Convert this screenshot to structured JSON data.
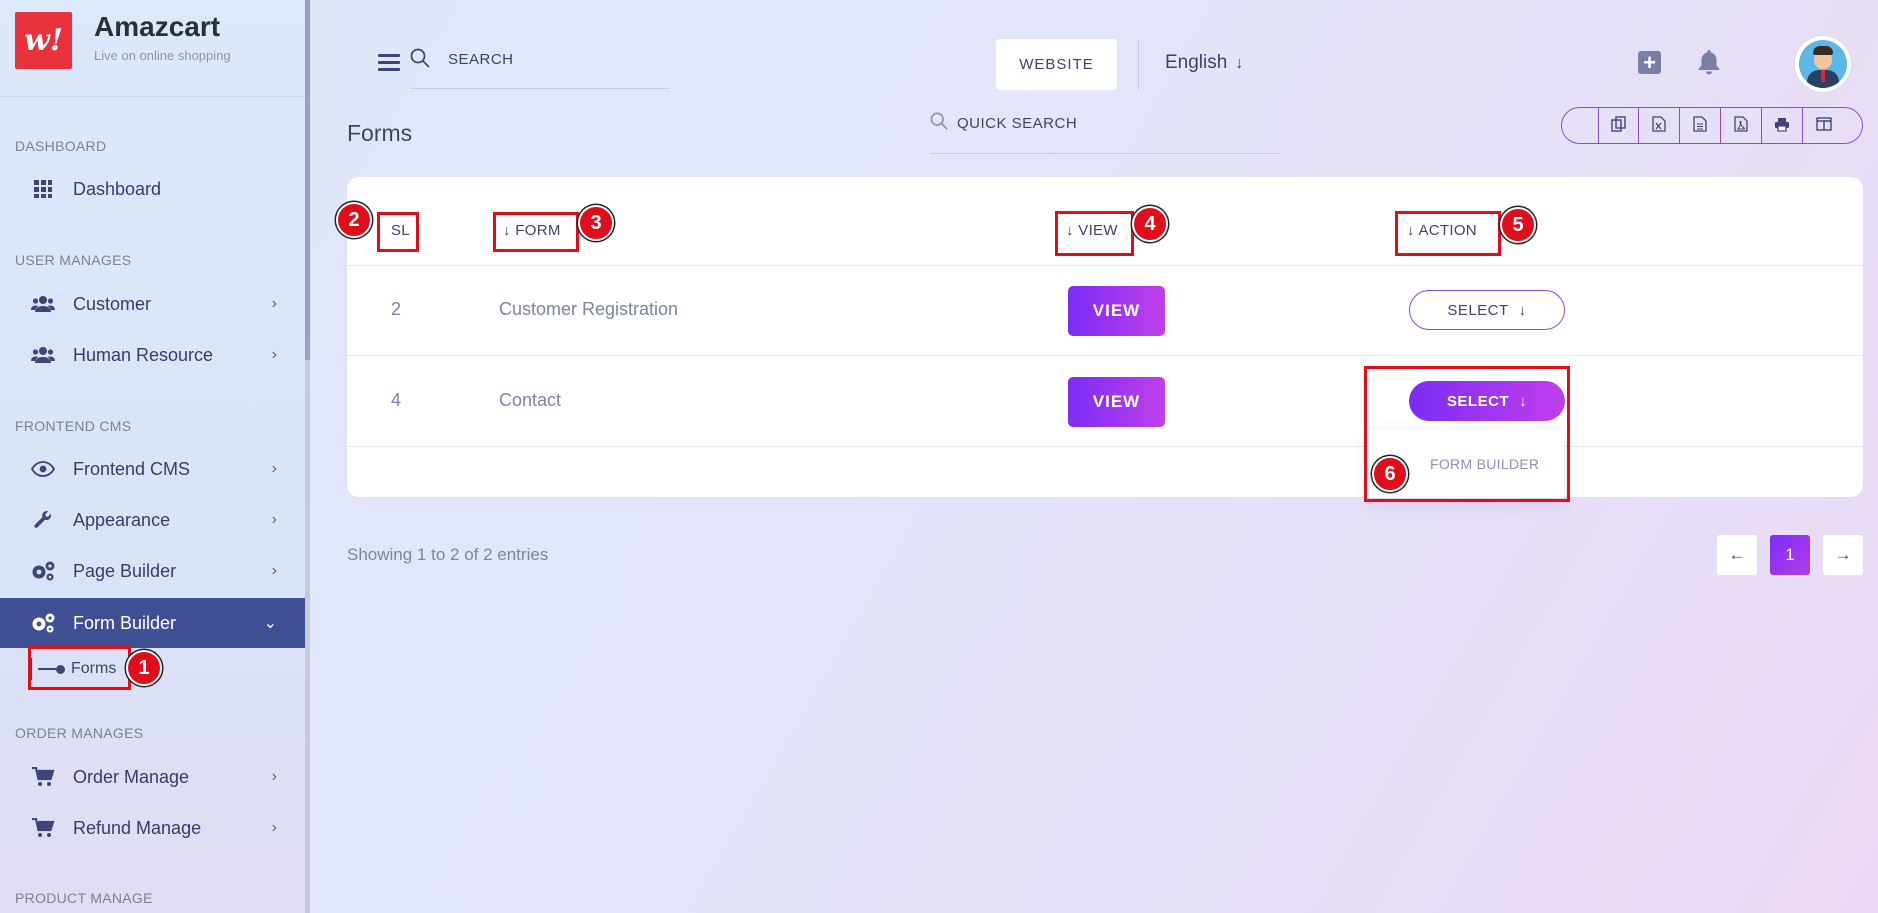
{
  "brand": {
    "name": "Amazcart",
    "tagline": "Live on online shopping",
    "logo_glyph": "w!"
  },
  "sidebar": {
    "sections": {
      "dashboard": "DASHBOARD",
      "user_manages": "USER MANAGES",
      "frontend_cms": "FRONTEND CMS",
      "order_manages": "ORDER MANAGES",
      "product_manage": "PRODUCT MANAGE"
    },
    "items": {
      "dashboard": "Dashboard",
      "customer": "Customer",
      "human_resource": "Human Resource",
      "frontend_cms": "Frontend CMS",
      "appearance": "Appearance",
      "page_builder": "Page Builder",
      "form_builder": "Form Builder",
      "forms": "Forms",
      "order_manage": "Order Manage",
      "refund_manage": "Refund Manage"
    }
  },
  "header": {
    "search_placeholder": "SEARCH",
    "website_label": "WEBSITE",
    "language": "English"
  },
  "page": {
    "title": "Forms",
    "quick_search_placeholder": "QUICK SEARCH"
  },
  "table": {
    "headers": {
      "sl": "SL",
      "form": "FORM",
      "view": "VIEW",
      "action": "ACTION"
    },
    "rows": [
      {
        "sl": "2",
        "form": "Customer Registration",
        "view": "VIEW",
        "action": "SELECT"
      },
      {
        "sl": "4",
        "form": "Contact",
        "view": "VIEW",
        "action": "SELECT"
      }
    ],
    "dropdown_item": "FORM BUILDER",
    "entries_text": "Showing 1 to 2 of 2 entries",
    "current_page": "1"
  },
  "annotations": [
    "1",
    "2",
    "3",
    "4",
    "5",
    "6"
  ],
  "colors": {
    "accent_start": "#7c2cf6",
    "accent_end": "#c03fea",
    "sidebar_active": "#3f4f93",
    "annotation_red": "#e00d1d",
    "brand_red": "#e8313c"
  }
}
